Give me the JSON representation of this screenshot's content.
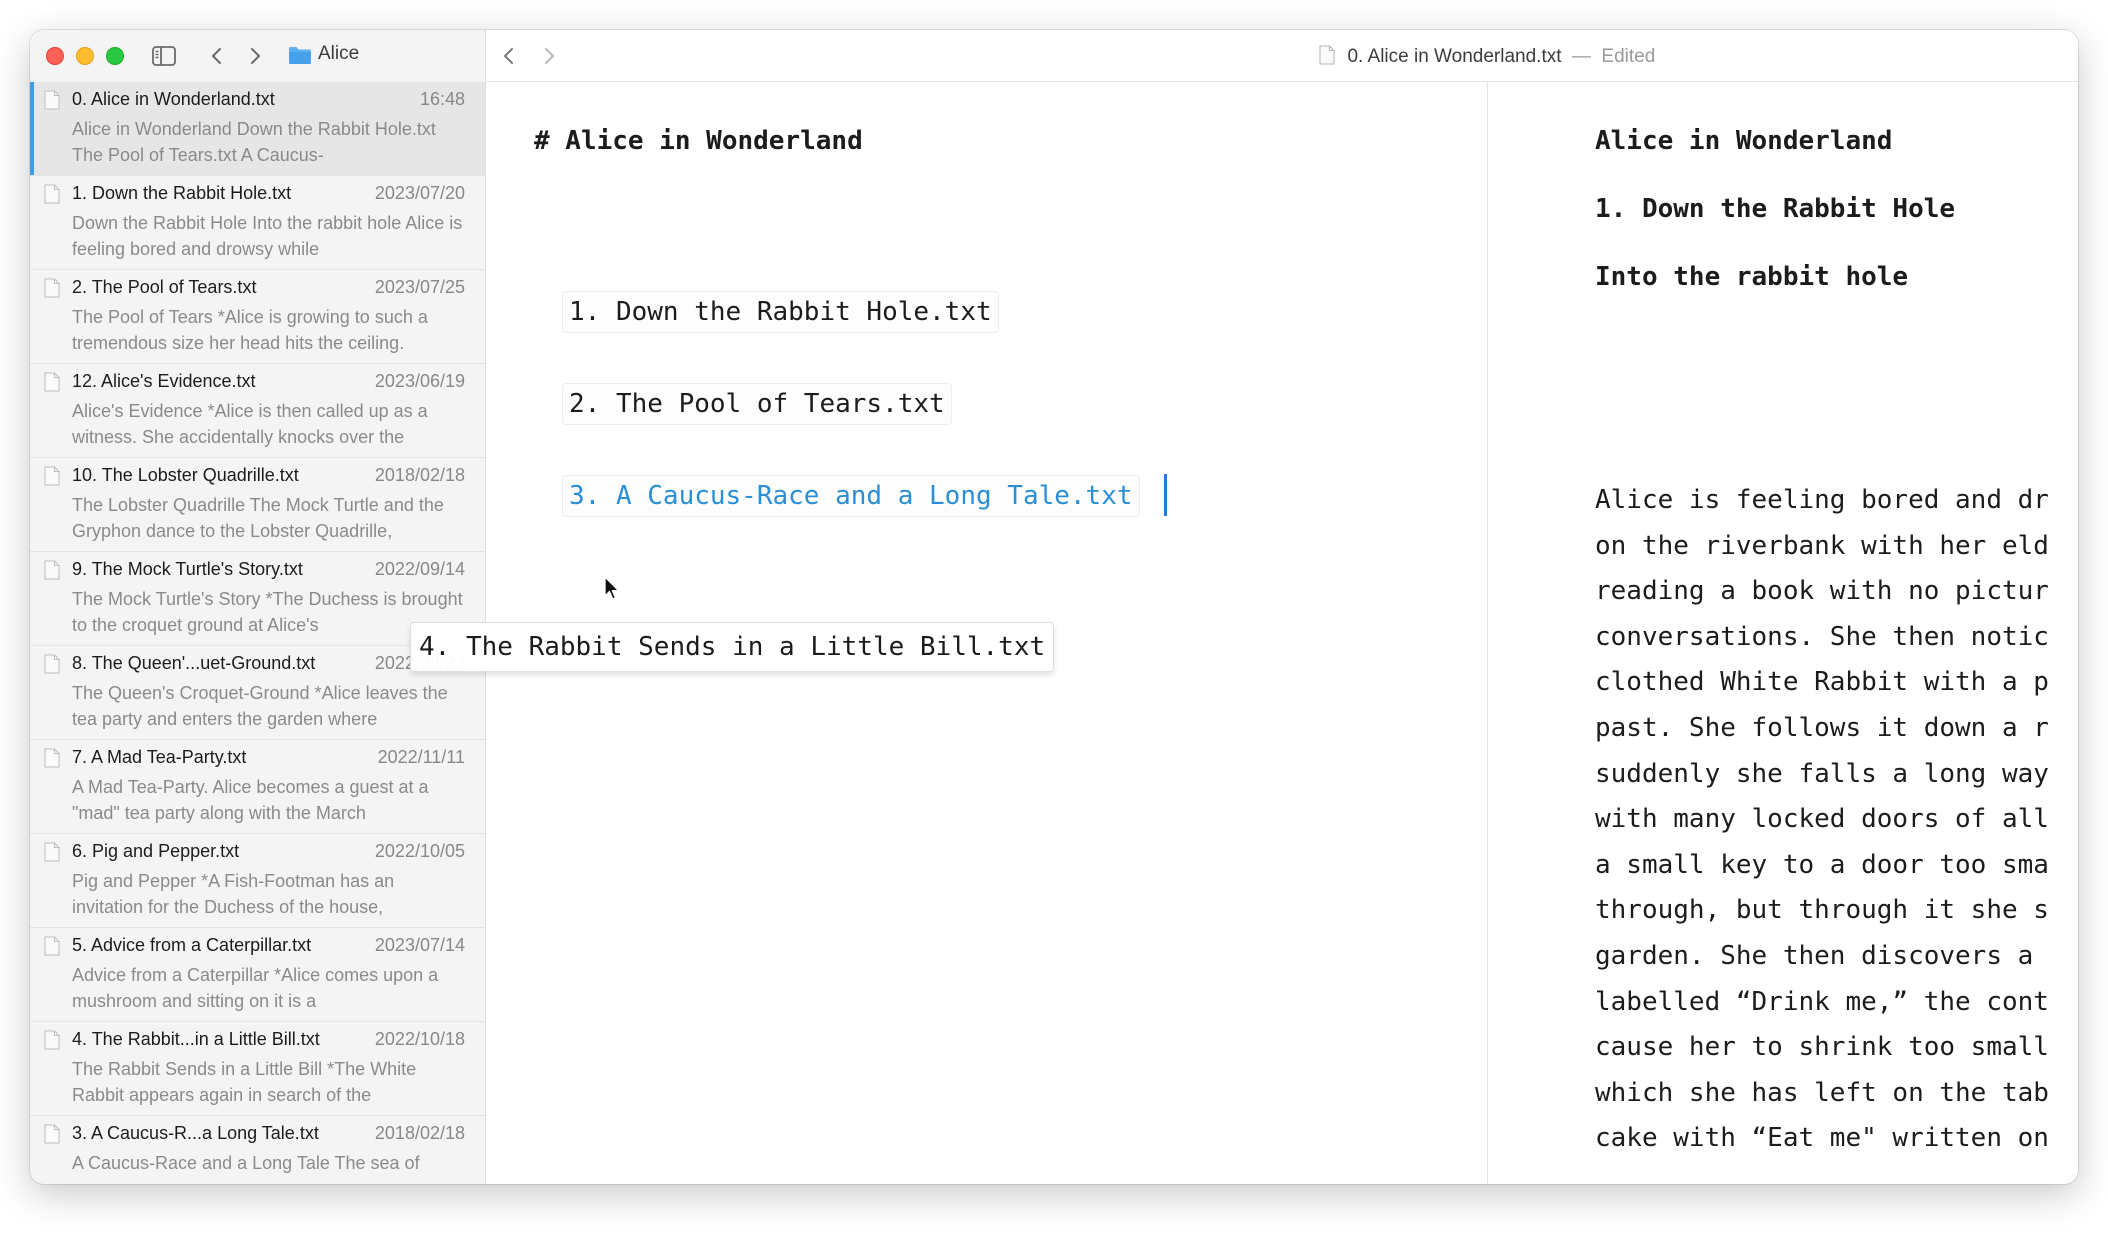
{
  "sidebar": {
    "folder_name": "Alice",
    "files": [
      {
        "title": "0. Alice in Wonderland.txt",
        "date": "16:48",
        "preview": "Alice in Wonderland Down the Rabbit Hole.txt The Pool of Tears.txt A Caucus-",
        "selected": true
      },
      {
        "title": "1. Down the Rabbit Hole.txt",
        "date": "2023/07/20",
        "preview": "Down the Rabbit Hole Into the rabbit hole Alice is feeling bored and drowsy while"
      },
      {
        "title": "2. The Pool of Tears.txt",
        "date": "2023/07/25",
        "preview": "The Pool of Tears *Alice is growing to such a tremendous size her head hits the ceiling."
      },
      {
        "title": "12. Alice's Evidence.txt",
        "date": "2023/06/19",
        "preview": "Alice's Evidence *Alice is then called up as a witness. She accidentally knocks over the"
      },
      {
        "title": "10. The Lobster Quadrille.txt",
        "date": "2018/02/18",
        "preview": "The Lobster Quadrille The Mock Turtle and the Gryphon dance to the Lobster Quadrille,"
      },
      {
        "title": "9. The Mock Turtle's Story.txt",
        "date": "2022/09/14",
        "preview": "The Mock Turtle's Story *The Duchess is brought to the croquet ground at Alice's"
      },
      {
        "title": "8. The Queen'...uet-Ground.txt",
        "date": "2022/08/23",
        "preview": "The Queen's Croquet-Ground *Alice leaves the tea party and enters the garden where"
      },
      {
        "title": "7. A Mad Tea-Party.txt",
        "date": "2022/11/11",
        "preview": "A Mad Tea-Party. Alice becomes a guest at a \"mad\" tea party along with the March"
      },
      {
        "title": "6. Pig and Pepper.txt",
        "date": "2022/10/05",
        "preview": "Pig and Pepper *A Fish-Footman has an invitation for the Duchess of the house,"
      },
      {
        "title": "5. Advice from a Caterpillar.txt",
        "date": "2023/07/14",
        "preview": "Advice from a Caterpillar *Alice comes upon a mushroom and sitting on it is a"
      },
      {
        "title": "4. The Rabbit...in a Little Bill.txt",
        "date": "2022/10/18",
        "preview": "The Rabbit Sends in a Little Bill *The White Rabbit appears again in search of the"
      },
      {
        "title": "3. A Caucus-R...a Long Tale.txt",
        "date": "2018/02/18",
        "preview": "A Caucus-Race and a Long Tale The sea of"
      }
    ]
  },
  "toolbar": {
    "doc_title": "0. Alice in Wonderland.txt",
    "separator": "—",
    "status": "Edited"
  },
  "editor": {
    "heading": "# Alice in Wonderland",
    "links": [
      "1. Down the Rabbit Hole.txt",
      "2. The Pool of Tears.txt",
      "3. A Caucus-Race and a Long Tale.txt"
    ],
    "dragging_item": "4. The Rabbit Sends in a Little Bill.txt"
  },
  "preview": {
    "h1": "Alice in Wonderland",
    "h2": "1. Down the Rabbit Hole",
    "h3": "Into the rabbit hole",
    "body_lines": [
      "Alice is feeling bored and dr",
      "on the riverbank with her eld",
      "reading a book with no pictur",
      "conversations. She then notic",
      "clothed White Rabbit with a p",
      "past. She follows it down a r",
      "suddenly she falls a long way",
      "with many locked doors of all",
      "a small key to a door too sma",
      "through, but through it she s",
      "garden. She then discovers a ",
      "labelled “Drink me,” the cont",
      "cause her to shrink too small",
      "which she has left on the tab",
      "cake with “Eat me\" written on"
    ]
  },
  "colors": {
    "accent": "#3b9fe5",
    "link_active": "#2a8fd6",
    "traffic_red": "#fe5f57",
    "traffic_yellow": "#febc2e",
    "traffic_green": "#28c840"
  }
}
